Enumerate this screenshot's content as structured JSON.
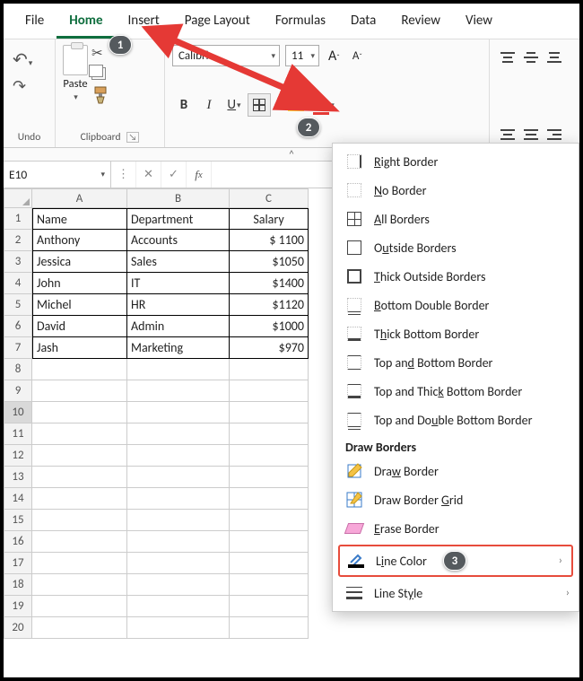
{
  "tabs": [
    "File",
    "Home",
    "Insert",
    "Page Layout",
    "Formulas",
    "Data",
    "Review",
    "View"
  ],
  "active_tab": "Home",
  "ribbon": {
    "undo_label": "Undo",
    "clipboard_label": "Clipboard",
    "paste_label": "Paste",
    "font": {
      "name": "Calibri",
      "size": "11"
    }
  },
  "namebox": "E10",
  "columns": [
    "A",
    "B",
    "C"
  ],
  "header_row": [
    "Name",
    "Department",
    "Salary"
  ],
  "rows": [
    [
      "Anthony",
      "Accounts",
      "$ 1100"
    ],
    [
      "Jessica",
      "Sales",
      "$1050"
    ],
    [
      "John",
      "IT",
      "$1400"
    ],
    [
      "Michel",
      "HR",
      "$1120"
    ],
    [
      "David",
      "Admin",
      "$1000"
    ],
    [
      "Jash",
      "Marketing",
      "$970"
    ]
  ],
  "selected_row": 10,
  "empty_rows_start": 8,
  "empty_rows_end": 20,
  "menu": {
    "items_top": [
      {
        "icon": "right",
        "label_pre": "",
        "u": "R",
        "label": "ight Border"
      },
      {
        "icon": "none",
        "label_pre": "",
        "u": "N",
        "label": "o Border"
      },
      {
        "icon": "all",
        "label_pre": "",
        "u": "A",
        "label": "ll Borders"
      },
      {
        "icon": "outside",
        "label_pre": "O",
        "u": "u",
        "label": "tside Borders"
      },
      {
        "icon": "thick",
        "label_pre": "",
        "u": "T",
        "label": "hick Outside Borders"
      },
      {
        "icon": "bottom-dbl",
        "label_pre": "",
        "u": "B",
        "label": "ottom Double Border"
      },
      {
        "icon": "thick-bottom",
        "label_pre": "T",
        "u": "h",
        "label": "ick Bottom Border"
      },
      {
        "icon": "top-bottom",
        "label_pre": "Top an",
        "u": "d",
        "label": " Bottom Border"
      },
      {
        "icon": "top-thickbottom",
        "label_pre": "Top and Thic",
        "u": "k",
        "label": " Bottom Border"
      },
      {
        "icon": "top-dblbottom",
        "label_pre": "Top and Do",
        "u": "u",
        "label": "ble Bottom Border"
      }
    ],
    "section": "Draw Borders",
    "items_draw": [
      {
        "icon": "draw",
        "label_pre": "Dra",
        "u": "w",
        "label": " Border"
      },
      {
        "icon": "drawgrid",
        "label_pre": "Draw Border ",
        "u": "G",
        "label": "rid"
      },
      {
        "icon": "erase",
        "label_pre": "",
        "u": "E",
        "label": "rase Border"
      },
      {
        "icon": "linecolor",
        "label_pre": "L",
        "u": "i",
        "label": "ne Color",
        "sub": true,
        "boxed": true,
        "badge": "3"
      },
      {
        "icon": "linestyle",
        "label_pre": "Line St",
        "u": "y",
        "label": "le",
        "sub": true
      }
    ]
  },
  "badges": {
    "b1": "1",
    "b2": "2"
  }
}
